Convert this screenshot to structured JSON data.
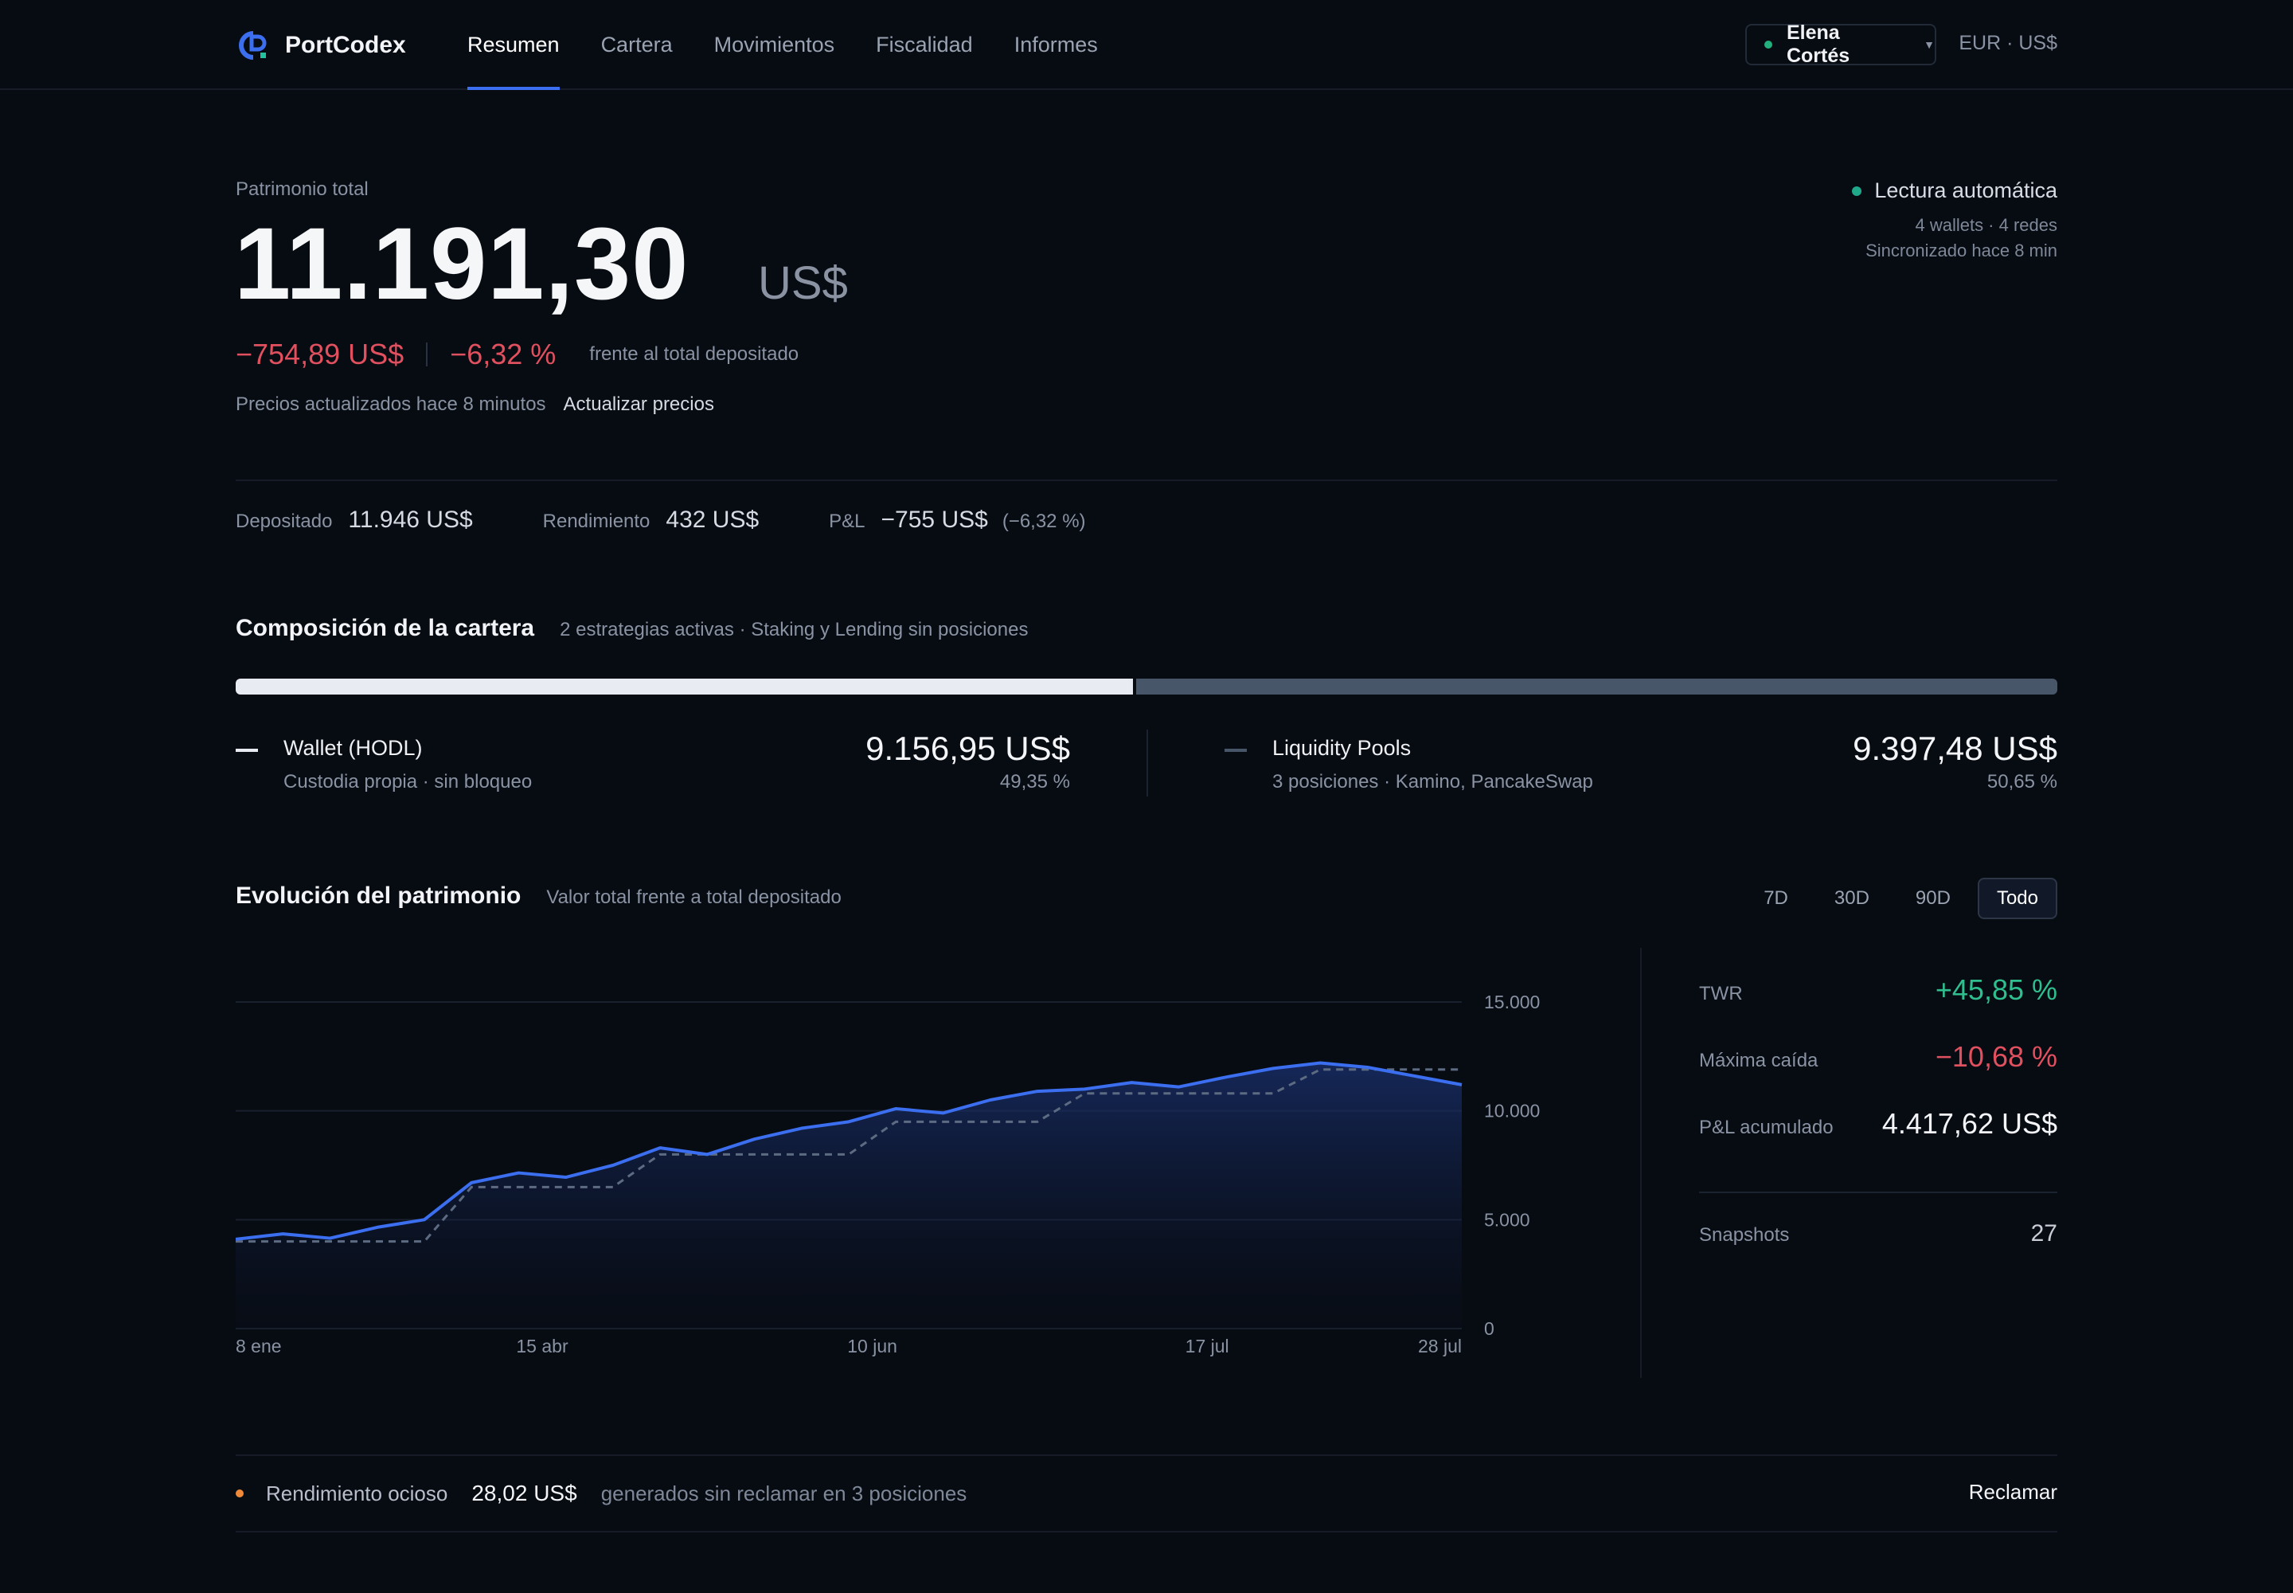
{
  "header": {
    "brand": "PortCodex",
    "nav": [
      "Resumen",
      "Cartera",
      "Movimientos",
      "Fiscalidad",
      "Informes"
    ],
    "active_nav": "Resumen",
    "user": "Elena Cortés",
    "currency": "EUR · US$"
  },
  "summary": {
    "label": "Patrimonio total",
    "value": "11.191,30",
    "unit": "US$",
    "pl_abs": "−754,89 US$",
    "pl_pct": "−6,32 %",
    "pl_note": "frente al total depositado",
    "updated": "Precios actualizados hace 8 minutos",
    "update_link": "Actualizar precios"
  },
  "auto_read": {
    "title": "Lectura automática",
    "line1": "4 wallets · 4 redes",
    "line2": "Sincronizado hace 8 min",
    "dot_color": "#1fa88a"
  },
  "stats": {
    "deposited_label": "Depositado",
    "deposited": "11.946 US$",
    "yield_label": "Rendimiento",
    "yield": "432 US$",
    "pl_label": "P&L",
    "pl": "−755 US$",
    "pl_pct": "(−6,32 %)"
  },
  "composition": {
    "title": "Composición de la cartera",
    "subtitle": "2 estrategias activas · Staking y Lending sin posiciones",
    "items": [
      {
        "name": "Wallet (HODL)",
        "desc": "Custodia propia · sin bloqueo",
        "amount": "9.156,95 US$",
        "pct": "49,35 %",
        "share": 49.35,
        "color": "#e8ebf1"
      },
      {
        "name": "Liquidity Pools",
        "desc": "3 posiciones · Kamino, PancakeSwap",
        "amount": "9.397,48 US$",
        "pct": "50,65 %",
        "share": 50.65,
        "color": "#475669"
      }
    ]
  },
  "evolution": {
    "title": "Evolución del patrimonio",
    "subtitle": "Valor total frente a total depositado",
    "ranges": [
      "7D",
      "30D",
      "90D",
      "Todo"
    ],
    "active_range": "Todo"
  },
  "chart_data": {
    "type": "area",
    "ylim": [
      0,
      15000
    ],
    "yticks": [
      "15.000",
      "10.000",
      "5.000",
      "0"
    ],
    "ytick_values": [
      15000,
      10000,
      5000,
      0
    ],
    "xticks": [
      "8 ene",
      "15 abr",
      "10 jun",
      "17 jul",
      "28 jul"
    ],
    "xtick_index": [
      0,
      6.5,
      13.5,
      20.6,
      26
    ],
    "series": [
      {
        "values": [
          4100,
          4350,
          4150,
          4650,
          5000,
          6700,
          7150,
          6950,
          7500,
          8300,
          8000,
          8700,
          9200,
          9500,
          10100,
          9900,
          10500,
          10900,
          11000,
          11300,
          11100,
          11550,
          11950,
          12200,
          12000,
          11600,
          11200
        ],
        "color": "#3b6ff0"
      },
      {
        "values": [
          4000,
          4000,
          4000,
          4000,
          4000,
          6500,
          6500,
          6500,
          6500,
          8000,
          8000,
          8000,
          8000,
          8000,
          9500,
          9500,
          9500,
          9500,
          10800,
          10800,
          10800,
          10800,
          10800,
          11900,
          11900,
          11900,
          11900
        ],
        "color": "#5d6b82",
        "dashed": true
      }
    ]
  },
  "metrics": {
    "twr_label": "TWR",
    "twr": "+45,85 %",
    "dd_label": "Máxima caída",
    "dd": "−10,68 %",
    "pl_label": "P&L acumulado",
    "pl": "4.417,62 US$",
    "snap_label": "Snapshots",
    "snap": "27"
  },
  "idle": {
    "label": "Rendimiento ocioso",
    "amount": "28,02 US$",
    "note": "generados sin reclamar en 3 posiciones",
    "action": "Reclamar",
    "dot_color": "#f08a3a"
  }
}
